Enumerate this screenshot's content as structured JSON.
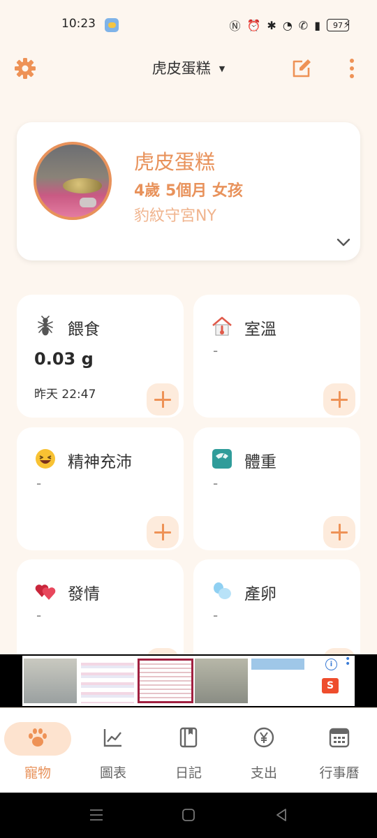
{
  "status_bar": {
    "time": "10:23",
    "battery": "97"
  },
  "header": {
    "pet_selector": "虎皮蛋糕"
  },
  "profile": {
    "name": "虎皮蛋糕",
    "age_gender": "4歲 5個月 女孩",
    "species": "豹紋守宮NY"
  },
  "cards": [
    {
      "title": "餵食",
      "value": "0.03 g",
      "time": "昨天 22:47",
      "icon": "ant-icon"
    },
    {
      "title": "室溫",
      "value": "-",
      "icon": "thermometer-house-icon"
    },
    {
      "title": "精神充沛",
      "value": "-",
      "icon": "happy-face-icon"
    },
    {
      "title": "體重",
      "value": "-",
      "icon": "scale-icon"
    },
    {
      "title": "發情",
      "value": "-",
      "icon": "hearts-icon"
    },
    {
      "title": "產卵",
      "value": "-",
      "icon": "eggs-icon"
    }
  ],
  "ad": {
    "info_label": "i",
    "shop_label": "S"
  },
  "nav": [
    {
      "label": "寵物",
      "icon": "paw-icon",
      "active": true
    },
    {
      "label": "圖表",
      "icon": "line-chart-icon"
    },
    {
      "label": "日記",
      "icon": "diary-icon"
    },
    {
      "label": "支出",
      "icon": "yen-icon"
    },
    {
      "label": "行事曆",
      "icon": "calendar-icon"
    }
  ],
  "colors": {
    "accent": "#e8925b",
    "background": "#fdf6ef",
    "add_bg": "#fdebdc"
  }
}
